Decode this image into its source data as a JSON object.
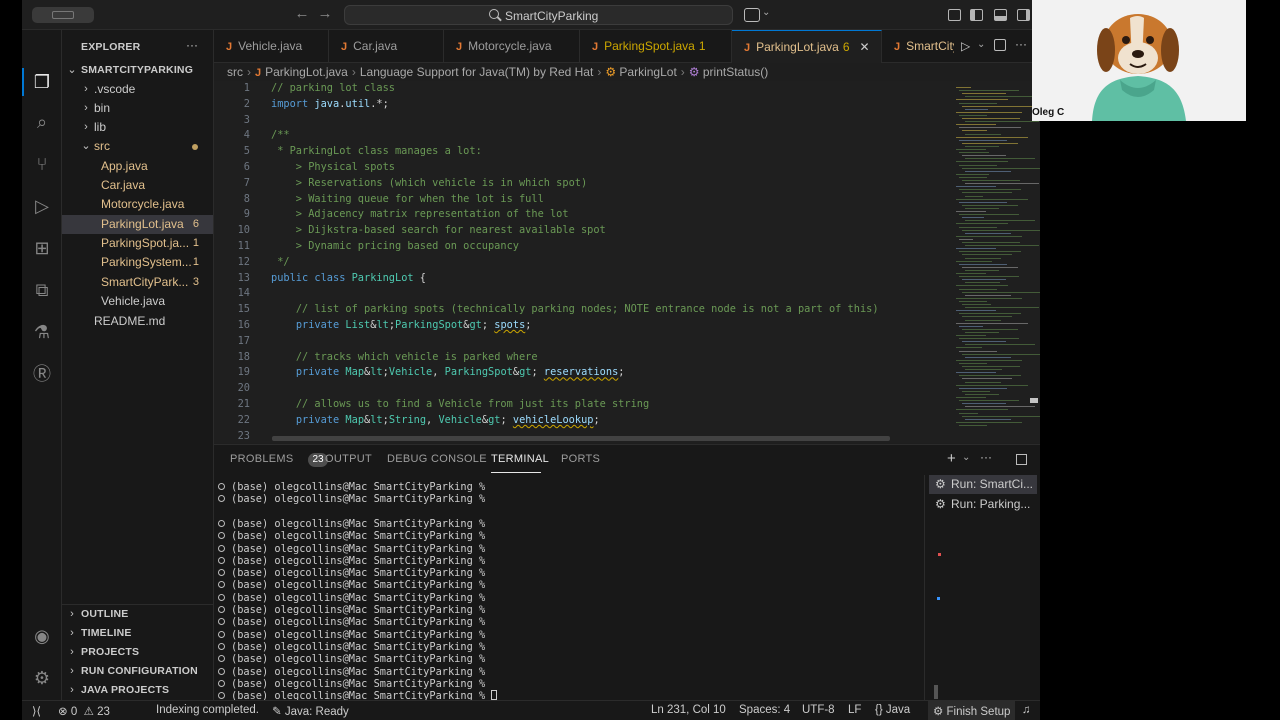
{
  "titlebar": {
    "search": "SmartCityParking"
  },
  "explorer": {
    "title": "EXPLORER",
    "more": "···",
    "root": "SMARTCITYPARKING",
    "items": [
      {
        "label": ".vscode",
        "kind": "folder"
      },
      {
        "label": "bin",
        "kind": "folder"
      },
      {
        "label": "lib",
        "kind": "folder"
      },
      {
        "label": "src",
        "kind": "folder-open"
      },
      {
        "label": "App.java",
        "kind": "file"
      },
      {
        "label": "Car.java",
        "kind": "file"
      },
      {
        "label": "Motorcycle.java",
        "kind": "file"
      },
      {
        "label": "ParkingLot.java",
        "kind": "file",
        "badge": "6"
      },
      {
        "label": "ParkingSpot.ja...",
        "kind": "file",
        "badge": "1"
      },
      {
        "label": "ParkingSystem...",
        "kind": "file",
        "badge": "1"
      },
      {
        "label": "SmartCityPark...",
        "kind": "file",
        "badge": "3"
      },
      {
        "label": "Vehicle.java",
        "kind": "file"
      },
      {
        "label": "README.md",
        "kind": "file"
      }
    ],
    "sections": [
      "OUTLINE",
      "TIMELINE",
      "PROJECTS",
      "RUN CONFIGURATION",
      "JAVA PROJECTS"
    ]
  },
  "tabs": [
    {
      "label": "Vehicle.java"
    },
    {
      "label": "Car.java"
    },
    {
      "label": "Motorcycle.java"
    },
    {
      "label": "ParkingSpot.java",
      "count": "1"
    },
    {
      "label": "ParkingLot.java",
      "count": "6",
      "active": true
    },
    {
      "label": "SmartCityP"
    }
  ],
  "breadcrumb": {
    "parts": [
      "src",
      "ParkingLot.java",
      "Language Support for Java(TM) by Red Hat",
      "ParkingLot",
      "printStatus()"
    ]
  },
  "code": {
    "lines": [
      {
        "n": "1",
        "t": "// parking lot class"
      },
      {
        "n": "2",
        "t": "import java.util.*;"
      },
      {
        "n": "3",
        "t": ""
      },
      {
        "n": "4",
        "t": "/**"
      },
      {
        "n": "5",
        "t": " * ParkingLot class manages a lot:"
      },
      {
        "n": "6",
        "t": "    > Physical spots"
      },
      {
        "n": "7",
        "t": "    > Reservations (which vehicle is in which spot)"
      },
      {
        "n": "8",
        "t": "    > Waiting queue for when the lot is full"
      },
      {
        "n": "9",
        "t": "    > Adjacency matrix representation of the lot"
      },
      {
        "n": "10",
        "t": "    > Dijkstra-based search for nearest available spot"
      },
      {
        "n": "11",
        "t": "    > Dynamic pricing based on occupancy"
      },
      {
        "n": "12",
        "t": " */"
      },
      {
        "n": "13",
        "t": "public class ParkingLot {"
      },
      {
        "n": "14",
        "t": ""
      },
      {
        "n": "15",
        "t": "    // list of parking spots (technically parking nodes; NOTE entrance node is not a part of this)"
      },
      {
        "n": "16",
        "t": "    private List<ParkingSpot> spots;"
      },
      {
        "n": "17",
        "t": ""
      },
      {
        "n": "18",
        "t": "    // tracks which vehicle is parked where"
      },
      {
        "n": "19",
        "t": "    private Map<Vehicle, ParkingSpot> reservations;"
      },
      {
        "n": "20",
        "t": ""
      },
      {
        "n": "21",
        "t": "    // allows us to find a Vehicle from just its plate string"
      },
      {
        "n": "22",
        "t": "    private Map<String, Vehicle> vehicleLookup;"
      },
      {
        "n": "23",
        "t": ""
      }
    ]
  },
  "panel": {
    "tabs": [
      "PROBLEMS",
      "OUTPUT",
      "DEBUG CONSOLE",
      "TERMINAL",
      "PORTS"
    ],
    "problems_count": "23",
    "terminal_lines": [
      "(base) olegcollins@Mac SmartCityParking %",
      "(base) olegcollins@Mac SmartCityParking %",
      "",
      "(base) olegcollins@Mac SmartCityParking %",
      "(base) olegcollins@Mac SmartCityParking %",
      "(base) olegcollins@Mac SmartCityParking %",
      "(base) olegcollins@Mac SmartCityParking %",
      "(base) olegcollins@Mac SmartCityParking %",
      "(base) olegcollins@Mac SmartCityParking %",
      "(base) olegcollins@Mac SmartCityParking %",
      "(base) olegcollins@Mac SmartCityParking %",
      "(base) olegcollins@Mac SmartCityParking %",
      "(base) olegcollins@Mac SmartCityParking %",
      "(base) olegcollins@Mac SmartCityParking %",
      "(base) olegcollins@Mac SmartCityParking %",
      "(base) olegcollins@Mac SmartCityParking %",
      "(base) olegcollins@Mac SmartCityParking %",
      "(base) olegcollins@Mac SmartCityParking %"
    ],
    "terminals": [
      "Run: SmartCi...",
      "Run: Parking..."
    ]
  },
  "statusbar": {
    "errors": "0",
    "warnings": "23",
    "indexing": "Indexing completed.",
    "java_status": "Java: Ready",
    "position": "Ln 231, Col 10",
    "spaces": "Spaces: 4",
    "encoding": "UTF-8",
    "eol": "LF",
    "language": "Java",
    "setup": "Finish Setup"
  },
  "video": {
    "name": "Oleg C"
  },
  "colors": {
    "accent": "#0078d4",
    "warning": "#cca700",
    "comment": "#6a9955",
    "keyword": "#569cd6",
    "type": "#4ec9b0"
  }
}
